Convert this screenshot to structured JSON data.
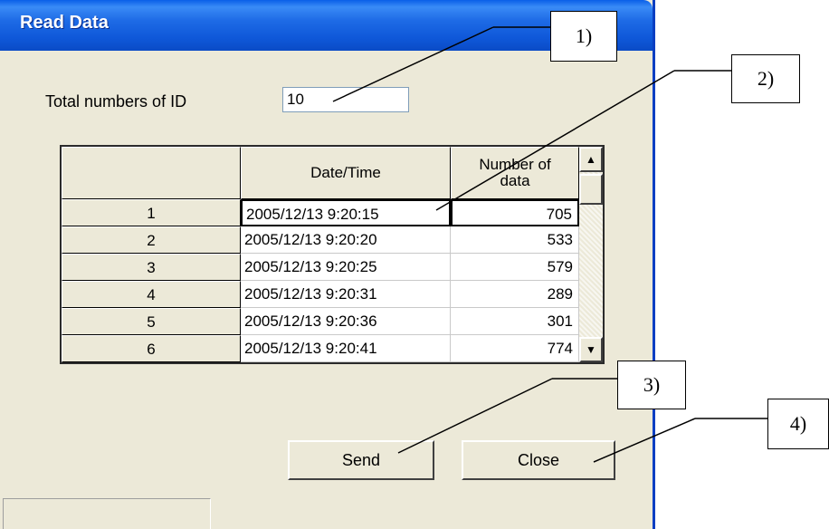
{
  "window": {
    "title": "Read Data"
  },
  "total": {
    "label": "Total numbers of ID",
    "value": "10"
  },
  "table": {
    "headers": {
      "date_time": "Date/Time",
      "number_of_data": "Number of\ndata"
    },
    "rows": [
      {
        "id": "1",
        "date_time": "2005/12/13 9:20:15",
        "count": "705"
      },
      {
        "id": "2",
        "date_time": "2005/12/13 9:20:20",
        "count": "533"
      },
      {
        "id": "3",
        "date_time": "2005/12/13 9:20:25",
        "count": "579"
      },
      {
        "id": "4",
        "date_time": "2005/12/13 9:20:31",
        "count": "289"
      },
      {
        "id": "5",
        "date_time": "2005/12/13 9:20:36",
        "count": "301"
      },
      {
        "id": "6",
        "date_time": "2005/12/13 9:20:41",
        "count": "774"
      }
    ]
  },
  "buttons": {
    "send": "Send",
    "close": "Close"
  },
  "scrollbar": {
    "up_icon": "triangle-up-icon",
    "down_icon": "triangle-down-icon"
  },
  "callouts": [
    "1)",
    "2)",
    "3)",
    "4)"
  ],
  "colors": {
    "titlebar": "#0A5FE8",
    "window_bg": "#ECE9D8",
    "border_blue": "#0A3FC2"
  }
}
